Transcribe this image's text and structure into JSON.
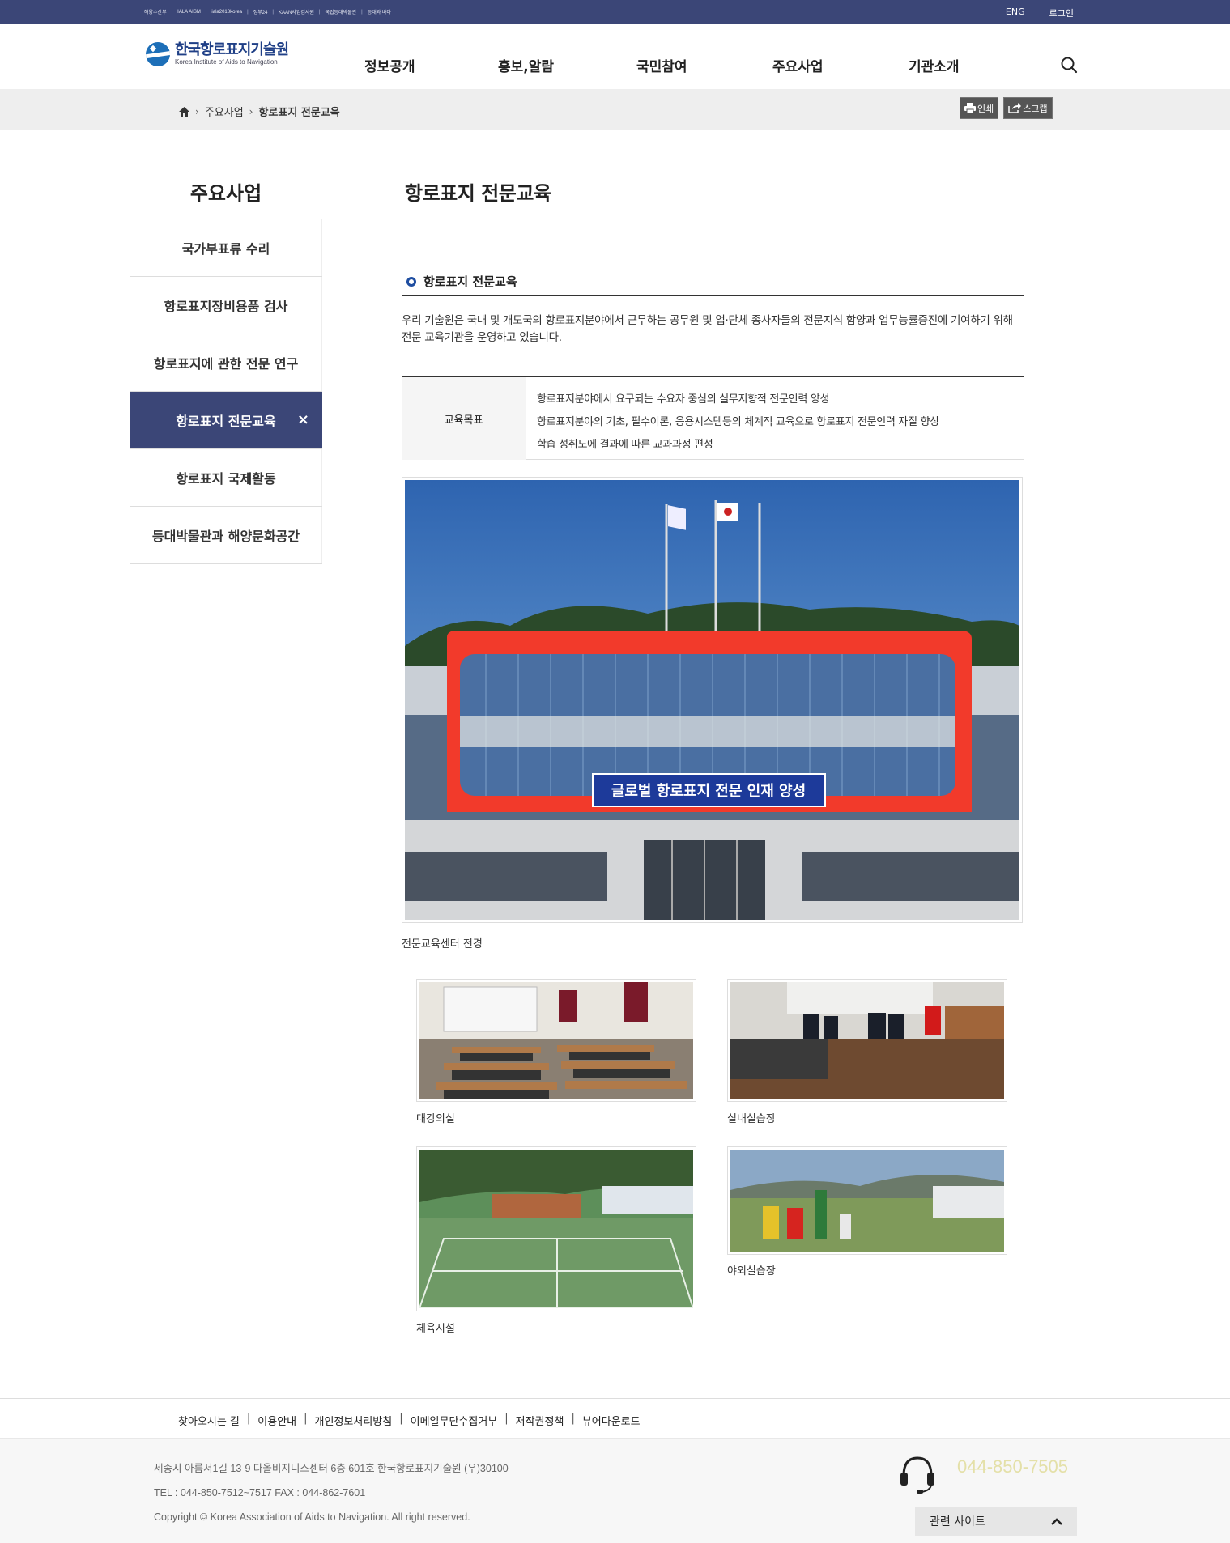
{
  "topbar": {
    "links": [
      "해양수산부",
      "IALA AISM",
      "iala2018korea",
      "정부24",
      "KAAN사업검사원",
      "국립등대박물관",
      "등대와 바다"
    ],
    "eng": "ENG",
    "login": "로그인"
  },
  "header": {
    "logo_ko": "한국항로표지기술원",
    "logo_en": "Korea Institute of Aids to Navigation",
    "gnb": [
      "정보공개",
      "홍보,알람",
      "국민참여",
      "주요사업",
      "기관소개"
    ]
  },
  "breadcrumb": {
    "items": [
      "주요사업",
      "항로표지 전문교육"
    ],
    "print": "인쇄",
    "scrap": "스크랩"
  },
  "lnb": {
    "title": "주요사업",
    "items": [
      "국가부표류 수리",
      "항로표지장비용품 검사",
      "항로표지에 관한 전문 연구",
      "항로표지 전문교육",
      "항로표지 국제활동",
      "등대박물관과 해양문화공간"
    ],
    "active_close": "×"
  },
  "content": {
    "page_title": "항로표지 전문교육",
    "section_title": "항로표지 전문교육",
    "intro": "우리 기술원은 국내 및 개도국의 항로표지분야에서 근무하는 공무원 및 업·단체 종사자들의 전문지식 함양과 업무능률증진에 기여하기 위해 전문 교육기관을 운영하고 있습니다.",
    "goal_head": "교육목표",
    "goals": [
      "항로표지분야에서 요구되는 수요자 중심의 실무지향적 전문인력 양성",
      "항로표지분야의 기초, 필수이론, 응용시스템등의 체계적 교육으로 항로표지 전문인력 자질 향상",
      "학습 성취도에 결과에 따른 교과과정 편성"
    ],
    "main_photo_banner": "글로벌 항로표지 전문 인재 양성",
    "main_caption": "전문교육센터 전경",
    "captions": [
      "대강의실",
      "실내실습장",
      "체육시설",
      "야외실습장"
    ]
  },
  "footer": {
    "links": [
      "찾아오시는 길",
      "이용안내",
      "개인정보처리방침",
      "이메일무단수집거부",
      "저작권정책",
      "뷰어다운로드"
    ],
    "address": "세종시 아름서1길 13-9 다올비지니스센터 6층 601호 한국항로표지기술원 (우)30100",
    "tel": "TEL : 044-850-7512~7517 FAX : 044-862-7601",
    "copyright": "Copyright © Korea Association of Aids to Navigation. All right reserved.",
    "phone": "044-850-7505",
    "related": "관련 사이트"
  },
  "colors": {
    "navy": "#3b4677",
    "brand_blue": "#1f3f86",
    "phone": "#e4e0a8"
  }
}
